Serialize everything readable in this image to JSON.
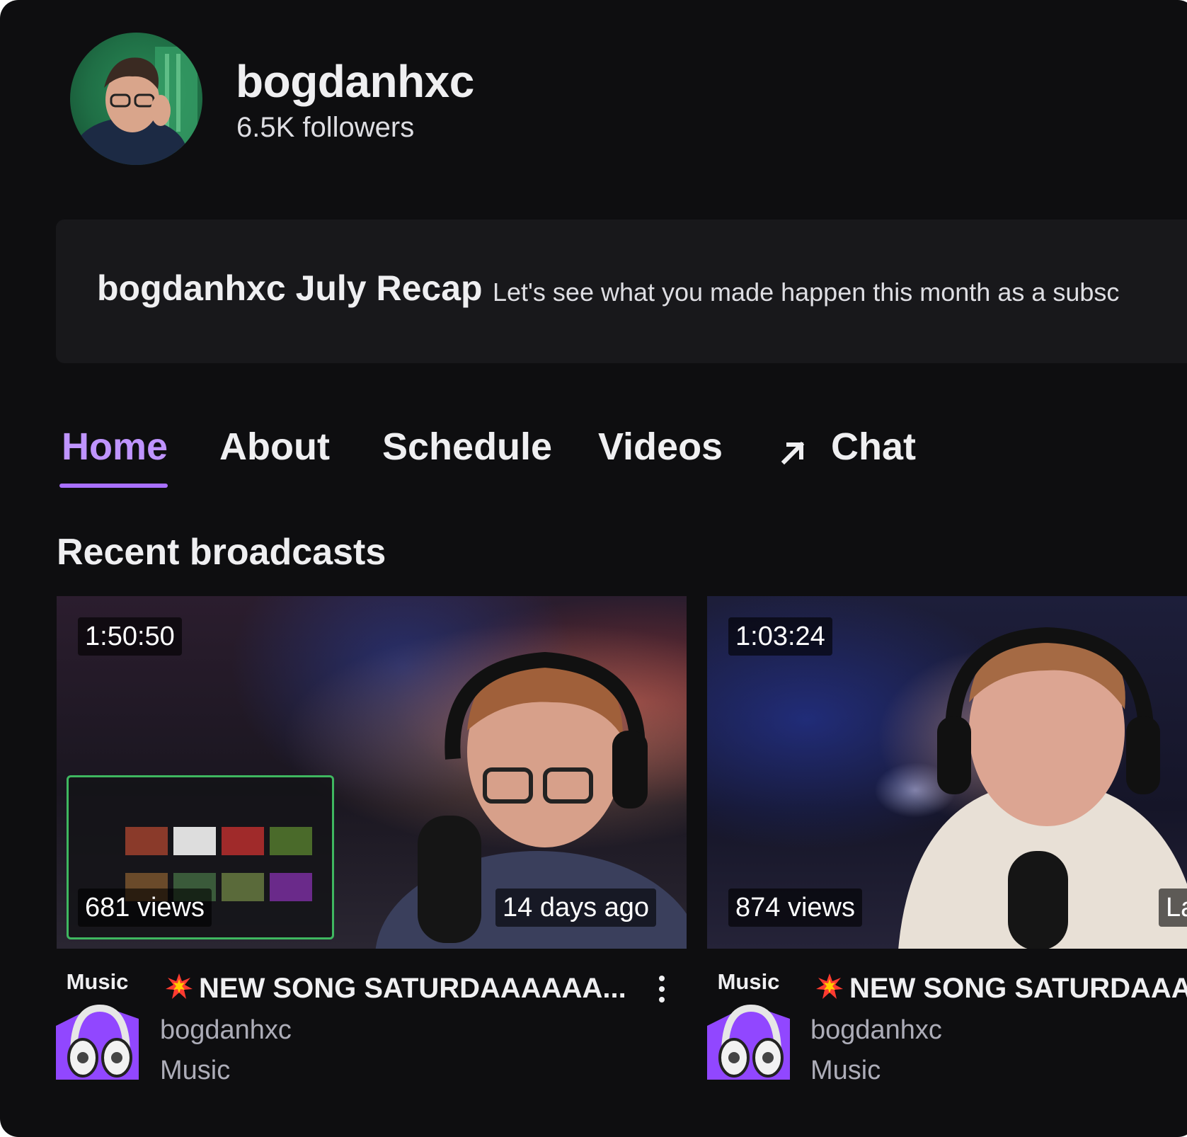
{
  "channel": {
    "name": "bogdanhxc",
    "followers": "6.5K followers"
  },
  "recap": {
    "title": "bogdanhxc July Recap",
    "description": "Let's see what you made happen this month as a subsc"
  },
  "tabs": [
    {
      "label": "Home",
      "active": true
    },
    {
      "label": "About",
      "active": false
    },
    {
      "label": "Schedule",
      "active": false
    },
    {
      "label": "Videos",
      "active": false
    },
    {
      "label": "Chat",
      "active": false,
      "icon": "external-arrow-icon"
    }
  ],
  "section": {
    "title": "Recent broadcasts"
  },
  "broadcasts": [
    {
      "duration": "1:50:50",
      "views": "681 views",
      "age": "14 days ago",
      "title": "NEW SONG SATURDAAAAAA...",
      "channel": "bogdanhxc",
      "category": "Music",
      "category_art_label": "Music"
    },
    {
      "duration": "1:03:24",
      "views": "874 views",
      "age": "La",
      "title": "NEW SONG SATURDAAA",
      "channel": "bogdanhxc",
      "category": "Music",
      "category_art_label": "Music"
    }
  ],
  "colors": {
    "background": "#0e0e10",
    "accent": "#a970ff",
    "active_tab": "#bf94ff",
    "card": "#18181b",
    "muted_text": "#adadb8"
  }
}
